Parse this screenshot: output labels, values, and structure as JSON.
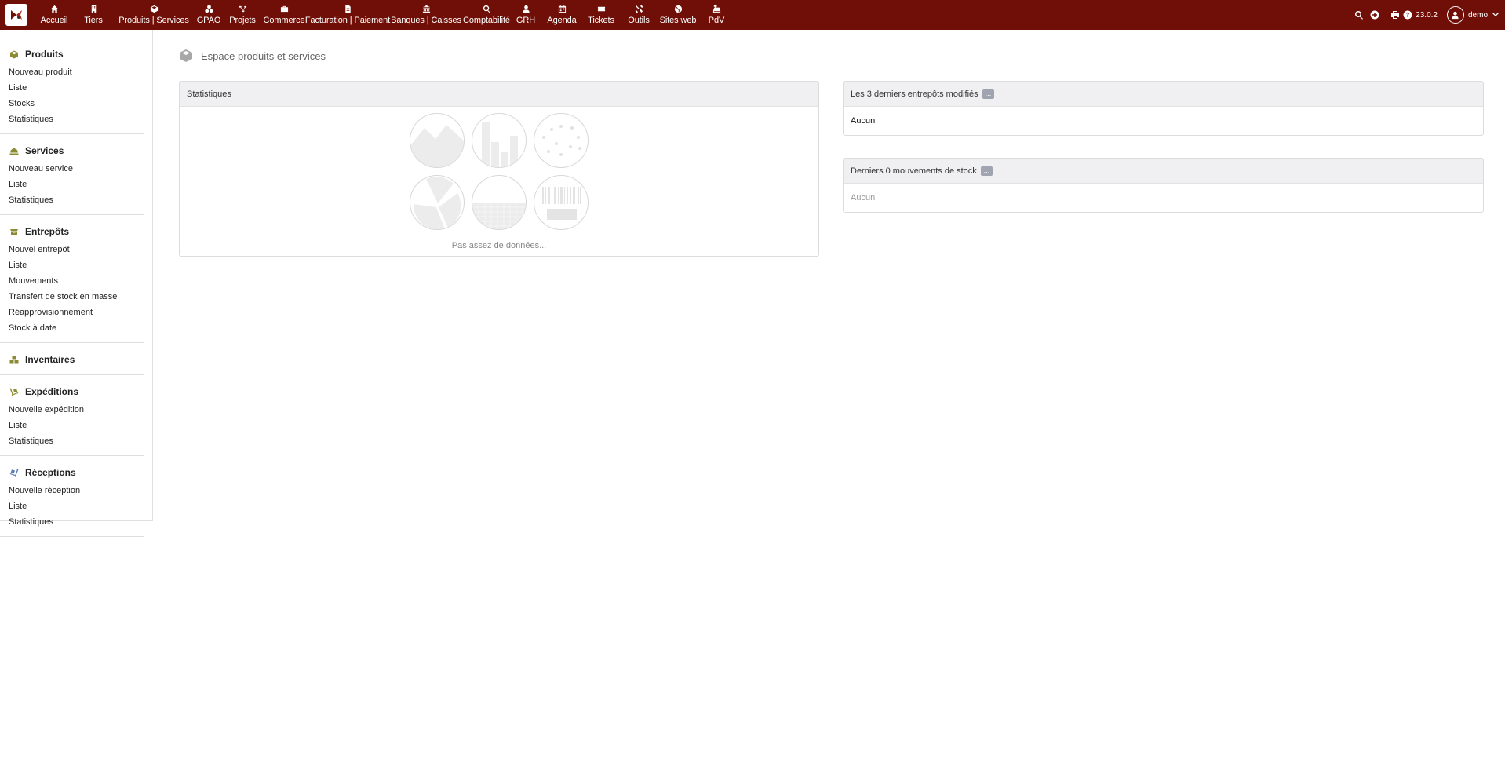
{
  "topnav": {
    "items": [
      {
        "label": "Accueil",
        "icon": "home-icon"
      },
      {
        "label": "Tiers",
        "icon": "building-icon"
      },
      {
        "label": "Produits | Services",
        "icon": "cube-icon"
      },
      {
        "label": "GPAO",
        "icon": "cubes-icon"
      },
      {
        "label": "Projets",
        "icon": "sitemap-icon"
      },
      {
        "label": "Commerce",
        "icon": "briefcase-icon"
      },
      {
        "label": "Facturation | Paiement",
        "icon": "file-invoice-icon"
      },
      {
        "label": "Banques | Caisses",
        "icon": "bank-icon"
      },
      {
        "label": "Comptabilité",
        "icon": "search-dollar-icon"
      },
      {
        "label": "GRH",
        "icon": "user-tie-icon"
      },
      {
        "label": "Agenda",
        "icon": "calendar-icon"
      },
      {
        "label": "Tickets",
        "icon": "ticket-icon"
      },
      {
        "label": "Outils",
        "icon": "tools-icon"
      },
      {
        "label": "Sites web",
        "icon": "globe-icon"
      },
      {
        "label": "PdV",
        "icon": "cash-register-icon"
      }
    ],
    "version": "23.0.2",
    "user": "demo"
  },
  "sidebar": {
    "sections": [
      {
        "title": "Produits",
        "icon": "cube-icon",
        "links": [
          "Nouveau produit",
          "Liste",
          "Stocks",
          "Statistiques"
        ]
      },
      {
        "title": "Services",
        "icon": "concierge-bell-icon",
        "links": [
          "Nouveau service",
          "Liste",
          "Statistiques"
        ]
      },
      {
        "title": "Entrepôts",
        "icon": "box-open-icon",
        "links": [
          "Nouvel entrepôt",
          "Liste",
          "Mouvements",
          "Transfert de stock en masse",
          "Réapprovisionnement",
          "Stock à date"
        ]
      },
      {
        "title": "Inventaires",
        "icon": "boxes-icon",
        "links": []
      },
      {
        "title": "Expéditions",
        "icon": "dolly-icon",
        "links": [
          "Nouvelle expédition",
          "Liste",
          "Statistiques"
        ]
      },
      {
        "title": "Réceptions",
        "icon": "dolly-flatbed-icon",
        "links": [
          "Nouvelle réception",
          "Liste",
          "Statistiques"
        ]
      }
    ]
  },
  "main": {
    "page_title": "Espace produits et services",
    "stats": {
      "title": "Statistiques",
      "no_data": "Pas assez de données..."
    },
    "warehouses": {
      "title": "Les 3 derniers entrepôts modifiés",
      "badge": "...",
      "empty": "Aucun"
    },
    "movements": {
      "title": "Derniers 0 mouvements de stock",
      "badge": "...",
      "empty": "Aucun"
    }
  },
  "colors": {
    "topbar": "#6f0f07",
    "section_icon": "#8b8b33"
  }
}
